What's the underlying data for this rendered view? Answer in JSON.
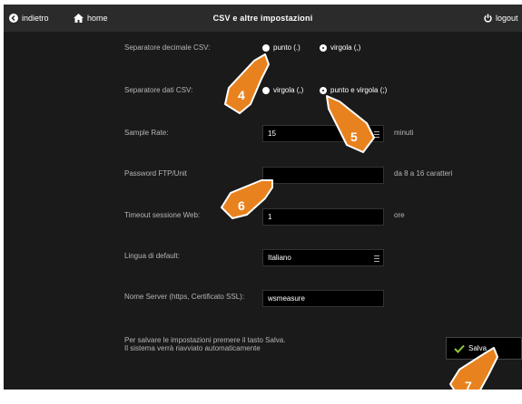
{
  "topbar": {
    "back_label": "indietro",
    "home_label": "home",
    "title": "CSV e altre impostazioni",
    "logout_label": "logout"
  },
  "settings": {
    "decimal_separator": {
      "label": "Separatore decimale CSV:",
      "options": [
        "punto (.)",
        "virgola (,)"
      ],
      "selected": "virgola (,)"
    },
    "data_separator": {
      "label": "Separatore dati CSV:",
      "options": [
        "virgola (,)",
        "punto e virgola (;)"
      ],
      "selected": "punto e virgola (;)"
    },
    "sample_rate": {
      "label": "Sample Rate:",
      "value": "15",
      "unit": "minuti"
    },
    "ftp_password": {
      "label": "Password FTP/Unit",
      "value": "",
      "hint": "da 8 a 16 caratteri"
    },
    "web_timeout": {
      "label": "Timeout sessione Web:",
      "value": "1",
      "unit": "ore"
    },
    "default_language": {
      "label": "Lingua di default:",
      "value": "Italiano"
    },
    "server_name": {
      "label": "Nome Server (https, Certificato SSL):",
      "value": "wsmeasure"
    }
  },
  "footer": {
    "note_line1": "Per salvare le impostazioni premere il tasto Salva.",
    "note_line2": "Il sistema verrà riavviato automaticamente",
    "save_label": "Salva"
  },
  "callouts": [
    "4",
    "5",
    "6",
    "7"
  ],
  "colors": {
    "callout": "#e8821e",
    "background": "#1a1a1a",
    "topbar": "#2b2b2b",
    "check": "#8dc63f"
  }
}
